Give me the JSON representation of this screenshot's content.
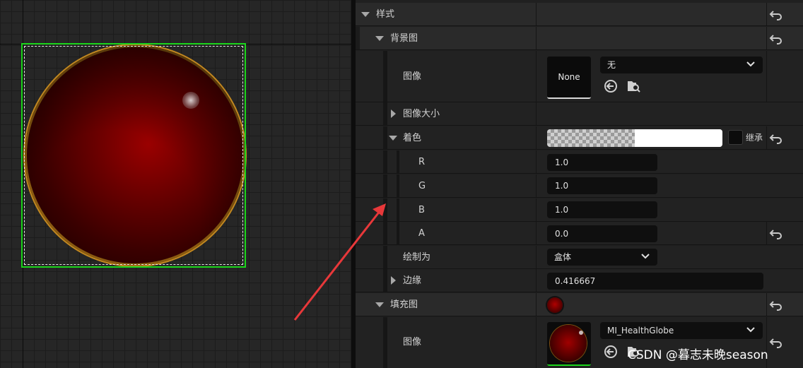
{
  "panel": {
    "style_section": {
      "label": "样式"
    },
    "background": {
      "label": "背景图",
      "image_label": "图像",
      "image_thumb_text": "None",
      "image_value": "无",
      "image_size_label": "图像大小",
      "tint": {
        "label": "着色",
        "inherit_label": "继承",
        "r_label": "R",
        "r_value": "1.0",
        "g_label": "G",
        "g_value": "1.0",
        "b_label": "B",
        "b_value": "1.0",
        "a_label": "A",
        "a_value": "0.0"
      },
      "draw_as_label": "绘制为",
      "draw_as_value": "盒体",
      "margin_label": "边缘",
      "margin_value": "0.416667"
    },
    "fill": {
      "label": "填充图",
      "image_label": "图像",
      "image_value": "MI_HealthGlobe"
    }
  },
  "watermark": "CSDN @暮志未晚season",
  "colors": {
    "selection_outline": "#1bd41b",
    "annotation_arrow": "#e8383a",
    "globe_red": "#8a0000"
  }
}
